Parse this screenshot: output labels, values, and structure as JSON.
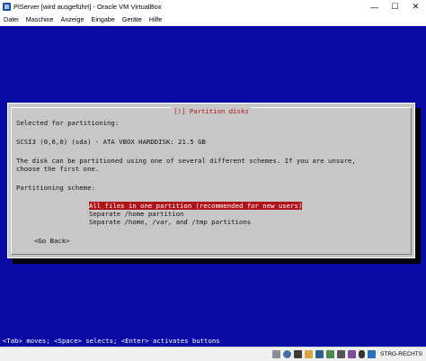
{
  "window": {
    "title": "PiServer [wird ausgeführt] - Oracle VM VirtualBox",
    "minimize_glyph": "—",
    "maximize_glyph": "☐",
    "close_glyph": "✕",
    "icon": "virtualbox-icon"
  },
  "menu": {
    "items": [
      "Datei",
      "Maschine",
      "Anzeige",
      "Eingabe",
      "Geräte",
      "Hilfe"
    ]
  },
  "installer": {
    "dialog_title": "[!] Partition disks",
    "selected_label": "Selected for partitioning:",
    "disk": "SCSI3 (0,0,0) (sda) - ATA VBOX HARDDISK: 21.5 GB",
    "description_line1": "The disk can be partitioned using one of several different schemes. If you are unsure,",
    "description_line2": "choose the first one.",
    "scheme_label": "Partitioning scheme:",
    "options": [
      "All files in one partition (recommended for new users)",
      "Separate /home partition",
      "Separate /home, /var, and /tmp partitions"
    ],
    "selected_option_index": 0,
    "go_back": "<Go Back>",
    "status_line": "<Tab> moves; <Space> selects; <Enter> activates buttons",
    "colors": {
      "screen_bg": "#0a0aa5",
      "dialog_bg": "#c7c7c7",
      "accent_red": "#b0141a"
    }
  },
  "statusbar": {
    "host_key": "STRG-RECHTS",
    "icons": [
      "hard-disk-icon",
      "optical-drive-icon",
      "usb-icon",
      "shared-folder-icon",
      "display-icon",
      "network-icon",
      "recording-icon",
      "cpu-icon",
      "mouse-integration-icon",
      "host-key-arrow-icon"
    ]
  }
}
